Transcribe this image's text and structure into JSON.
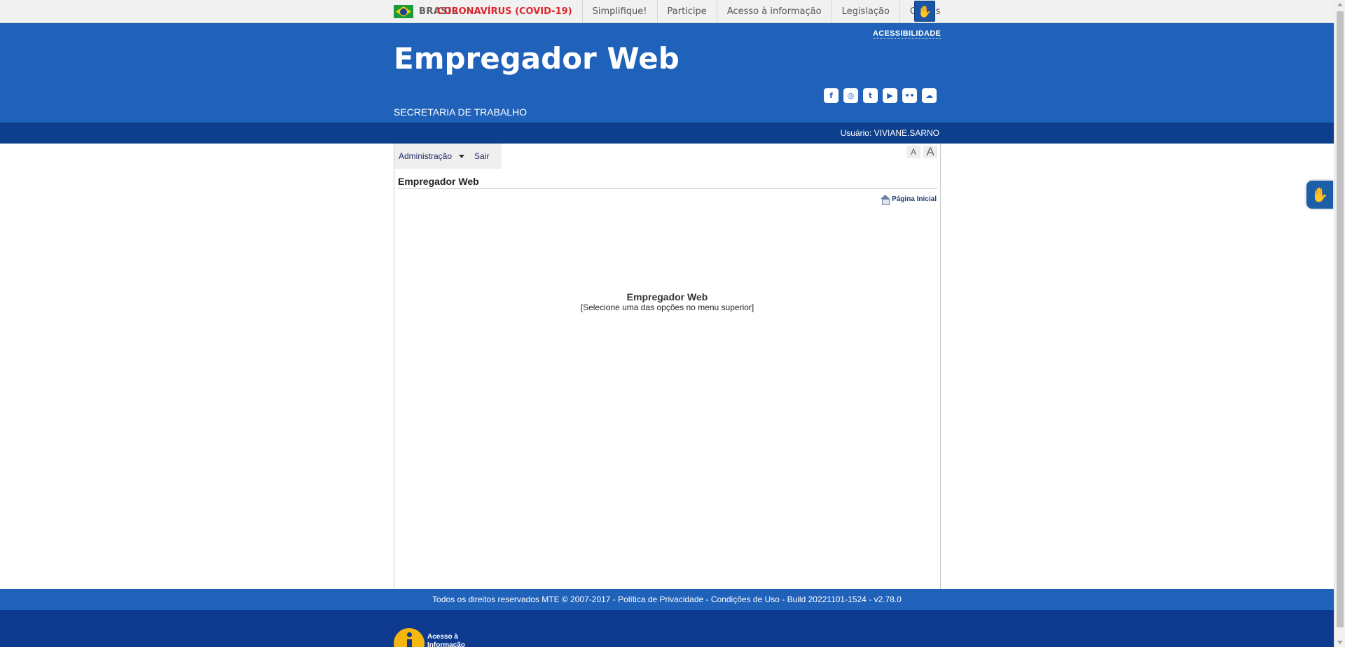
{
  "gov_bar": {
    "country": "BRASIL",
    "links": [
      "CORONAVÍRUS (COVID-19)",
      "Simplifique!",
      "Participe",
      "Acesso à informação",
      "Legislação",
      "Canais"
    ],
    "vlibras_icon": "hands-sign-icon"
  },
  "header": {
    "accessibility_link": "ACESSIBILIDADE",
    "title": "Empregador Web",
    "subtitle": "SECRETARIA DE TRABALHO",
    "socials": [
      {
        "name": "facebook-icon",
        "glyph": "f"
      },
      {
        "name": "instagram-icon",
        "glyph": "◎"
      },
      {
        "name": "twitter-icon",
        "glyph": "t"
      },
      {
        "name": "youtube-icon",
        "glyph": "▶"
      },
      {
        "name": "flickr-icon",
        "glyph": "••"
      },
      {
        "name": "soundcloud-icon",
        "glyph": "☁"
      }
    ]
  },
  "user_bar": {
    "user_label": "Usuário: VIVIANE.SARNO"
  },
  "menu": {
    "admin_label": "Administração",
    "logout_label": "Sair"
  },
  "font_controls": {
    "decrease_label": "A",
    "increase_label": "A"
  },
  "content": {
    "page_title": "Empregador Web",
    "home_link": "Página Inicial",
    "center_title": "Empregador Web",
    "center_hint": "[Selecione uma das opções no menu superior]"
  },
  "footer": {
    "copyright": "Todos os direitos reservados MTE © 2007-2017 - Política de Privacidade - Condições de Uso - Build 20221101-1524 - v2.78.0",
    "access_info": "Acesso à Informação"
  },
  "colors": {
    "header_blue": "#2062b9",
    "user_bar_blue": "#0e3f8c",
    "covid_red": "#d8272d",
    "footer_dark": "#0d3a8f"
  }
}
